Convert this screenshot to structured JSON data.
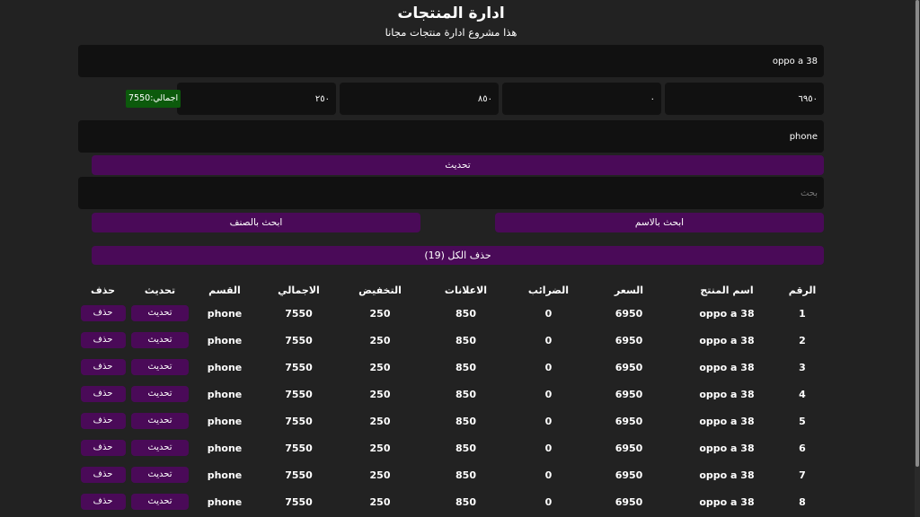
{
  "header": {
    "title": "ادارة المنتجات",
    "subtitle": "هذا مشروع ادارة منتجات مجانا"
  },
  "form": {
    "title_value": "oppo a 38",
    "price_value": "٦٩٥٠",
    "taxes_value": "٠",
    "ads_value": "٨٥٠",
    "discount_value": "٢٥٠",
    "total_label": "اجمالي:7550",
    "category_value": "phone",
    "update_label": "تحديث",
    "search_placeholder": "بحث",
    "search_by_name_label": "ابحث بالاسم",
    "search_by_category_label": "ابحث بالصنف",
    "delete_all_label": "حذف الكل (19)"
  },
  "colors": {
    "background": "#222222",
    "input_background": "#111111",
    "button_purple": "#4a0a58",
    "total_green": "#0c5a0c"
  },
  "table": {
    "headers": [
      "الرقم",
      "اسم المنتج",
      "السعر",
      "الضرائب",
      "الاعلانات",
      "التخفيض",
      "الاجمالي",
      "القسم",
      "تحديث",
      "حذف"
    ],
    "rows": [
      {
        "id": "1",
        "title": "oppo a 38",
        "price": "6950",
        "taxes": "0",
        "ads": "850",
        "discount": "250",
        "total": "7550",
        "category": "phone",
        "update": "تحديث",
        "delete": "حذف"
      },
      {
        "id": "2",
        "title": "oppo a 38",
        "price": "6950",
        "taxes": "0",
        "ads": "850",
        "discount": "250",
        "total": "7550",
        "category": "phone",
        "update": "تحديث",
        "delete": "حذف"
      },
      {
        "id": "3",
        "title": "oppo a 38",
        "price": "6950",
        "taxes": "0",
        "ads": "850",
        "discount": "250",
        "total": "7550",
        "category": "phone",
        "update": "تحديث",
        "delete": "حذف"
      },
      {
        "id": "4",
        "title": "oppo a 38",
        "price": "6950",
        "taxes": "0",
        "ads": "850",
        "discount": "250",
        "total": "7550",
        "category": "phone",
        "update": "تحديث",
        "delete": "حذف"
      },
      {
        "id": "5",
        "title": "oppo a 38",
        "price": "6950",
        "taxes": "0",
        "ads": "850",
        "discount": "250",
        "total": "7550",
        "category": "phone",
        "update": "تحديث",
        "delete": "حذف"
      },
      {
        "id": "6",
        "title": "oppo a 38",
        "price": "6950",
        "taxes": "0",
        "ads": "850",
        "discount": "250",
        "total": "7550",
        "category": "phone",
        "update": "تحديث",
        "delete": "حذف"
      },
      {
        "id": "7",
        "title": "oppo a 38",
        "price": "6950",
        "taxes": "0",
        "ads": "850",
        "discount": "250",
        "total": "7550",
        "category": "phone",
        "update": "تحديث",
        "delete": "حذف"
      },
      {
        "id": "8",
        "title": "oppo a 38",
        "price": "6950",
        "taxes": "0",
        "ads": "850",
        "discount": "250",
        "total": "7550",
        "category": "phone",
        "update": "تحديث",
        "delete": "حذف"
      }
    ]
  }
}
